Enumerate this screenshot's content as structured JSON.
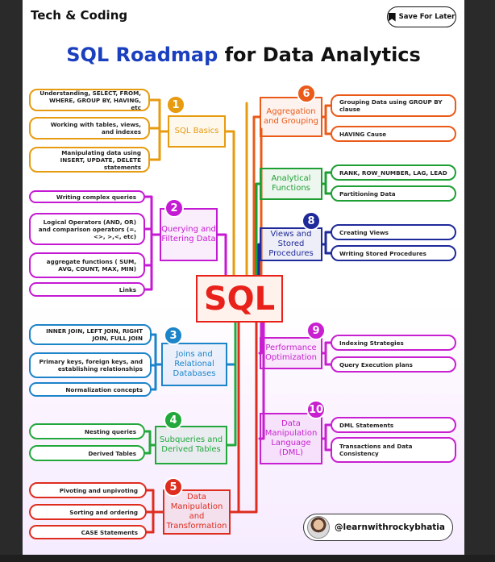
{
  "header": {
    "brand": "Tech & Coding",
    "save_label": "Save For Later"
  },
  "title": {
    "part1": "SQL Roadmap",
    "part2": "for Data Analytics"
  },
  "center": "SQL",
  "handle": "@learnwithrockybhatia",
  "topics": [
    {
      "num": "1",
      "title": "SQL Basics",
      "color": "#e79b10",
      "items": [
        "Understanding, SELECT, FROM, WHERE, GROUP BY, HAVING, etc",
        "Working with tables, views, and indexes",
        "Manipulating data using INSERT, UPDATE, DELETE statements"
      ]
    },
    {
      "num": "2",
      "title": "Querying and Filtering Data",
      "color": "#c51ad3",
      "items": [
        "Writing complex queries",
        "Logical Operators (AND, OR) and comparison operators (=, <>, >,<, etc)",
        "aggregate functions ( SUM, AVG, COUNT, MAX, MIN)",
        "Links"
      ]
    },
    {
      "num": "3",
      "title": "Joins and Relational Databases",
      "color": "#1c84c8",
      "items": [
        "INNER JOIN, LEFT JOIN, RIGHT JOIN, FULL JOIN",
        "Primary keys, foreign keys, and establishing relationships",
        "Normalization concepts"
      ]
    },
    {
      "num": "4",
      "title": "Subqueries and Derived Tables",
      "color": "#23a83c",
      "items": [
        "Nesting queries",
        "Derived Tables"
      ]
    },
    {
      "num": "5",
      "title": "Data Manipulation and Transformation",
      "color": "#de2d1e",
      "items": [
        "Pivoting and unpivoting",
        "Sorting and ordering",
        "CASE Statements"
      ]
    },
    {
      "num": "6",
      "title": "Aggregation and Grouping",
      "color": "#ea5a19",
      "items": [
        "Grouping Data using GROUP BY clause",
        "HAVING Cause"
      ]
    },
    {
      "num": "7",
      "title": "Analytical Functions",
      "color": "#1e9f34",
      "items": [
        "RANK, ROW_NUMBER, LAG, LEAD",
        "Partitioning Data"
      ]
    },
    {
      "num": "8",
      "title": "Views and Stored Procedures",
      "color": "#1f2a9a",
      "items": [
        "Creating Views",
        "Writing Stored Procedures"
      ]
    },
    {
      "num": "9",
      "title": "Performance Optimization",
      "color": "#c81fd0",
      "items": [
        "Indexing Strategies",
        "Query Execution plans"
      ]
    },
    {
      "num": "10",
      "title": "Data Manipulation Language (DML)",
      "color": "#c81fd0",
      "items": [
        "DML Statements",
        "Transactions and Data Consistency"
      ]
    }
  ]
}
